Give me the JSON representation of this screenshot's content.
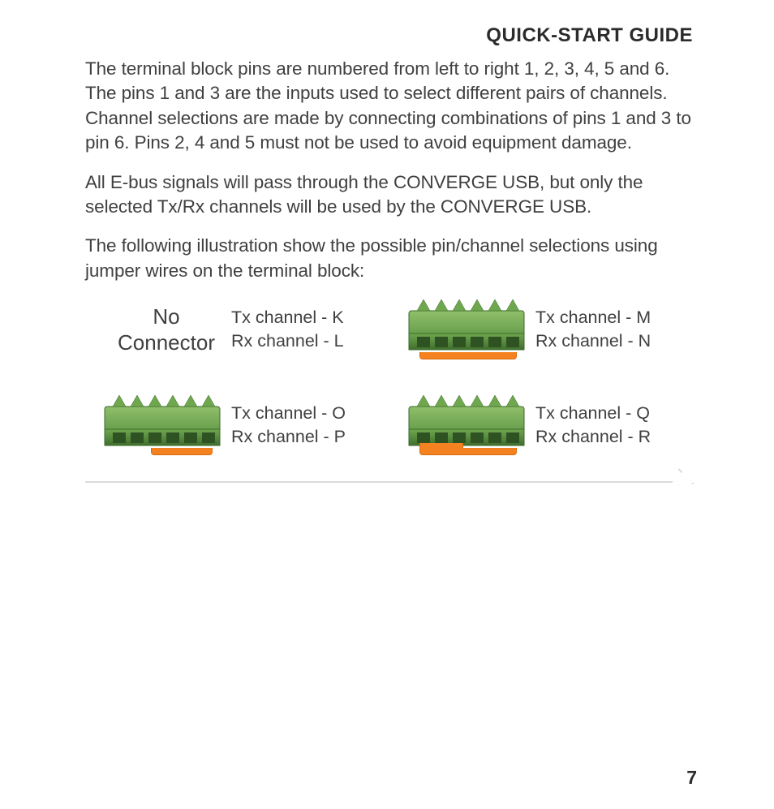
{
  "heading": "QUICK-START GUIDE",
  "paragraphs": {
    "p1": "The terminal block pins are numbered from left to right 1, 2, 3, 4, 5 and 6. The pins 1 and 3 are the inputs used to select different pairs of channels. Channel selections are made by connecting combinations of pins 1 and 3 to pin 6. Pins 2, 4 and 5 must not be used to avoid equipment damage.",
    "p2": "All E-bus signals will pass through the CONVERGE USB, but only the selected Tx/Rx channels will be used by the CONVERGE USB.",
    "p3": "The following illustration show the possible pin/channel selections using jumper wires on the terminal block:"
  },
  "selections": [
    {
      "image": "none",
      "tx": "Tx channel - K",
      "rx": "Rx channel - L",
      "no_connector_line1": "No",
      "no_connector_line2": "Connector"
    },
    {
      "image": "jumper_1_6",
      "tx": "Tx channel - M",
      "rx": "Rx channel - N"
    },
    {
      "image": "jumper_3_6",
      "tx": "Tx channel - O",
      "rx": "Rx channel - P"
    },
    {
      "image": "jumper_1_3_6",
      "tx": "Tx channel - Q",
      "rx": "Rx channel - R"
    }
  ],
  "page_number": "7"
}
